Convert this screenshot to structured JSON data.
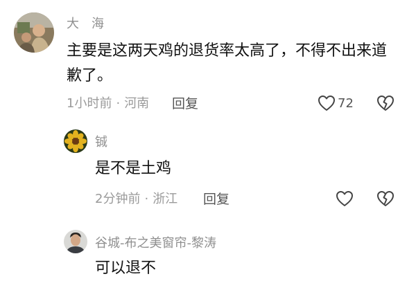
{
  "comments": [
    {
      "username": "大　海",
      "content": "主要是这两天鸡的退货率太高了，不得不出来道歉了。",
      "time": "1小时前",
      "separator": "·",
      "location": "河南",
      "reply_label": "回复",
      "like_count": "72",
      "avatar_icon": "person-photo-avatar"
    },
    {
      "username": "铖",
      "content": "是不是土鸡",
      "time": "2分钟前",
      "separator": "·",
      "location": "浙江",
      "reply_label": "回复",
      "like_count": "",
      "avatar_icon": "yellow-flower-avatar"
    },
    {
      "username": "谷城-布之美窗帘-黎涛",
      "content": "可以退不",
      "avatar_icon": "man-photo-avatar"
    }
  ],
  "icons": {
    "like": "heart-icon",
    "dislike": "broken-heart-icon"
  },
  "colors": {
    "text": "#111111",
    "muted": "#9a9a9a",
    "icon": "#444444"
  }
}
